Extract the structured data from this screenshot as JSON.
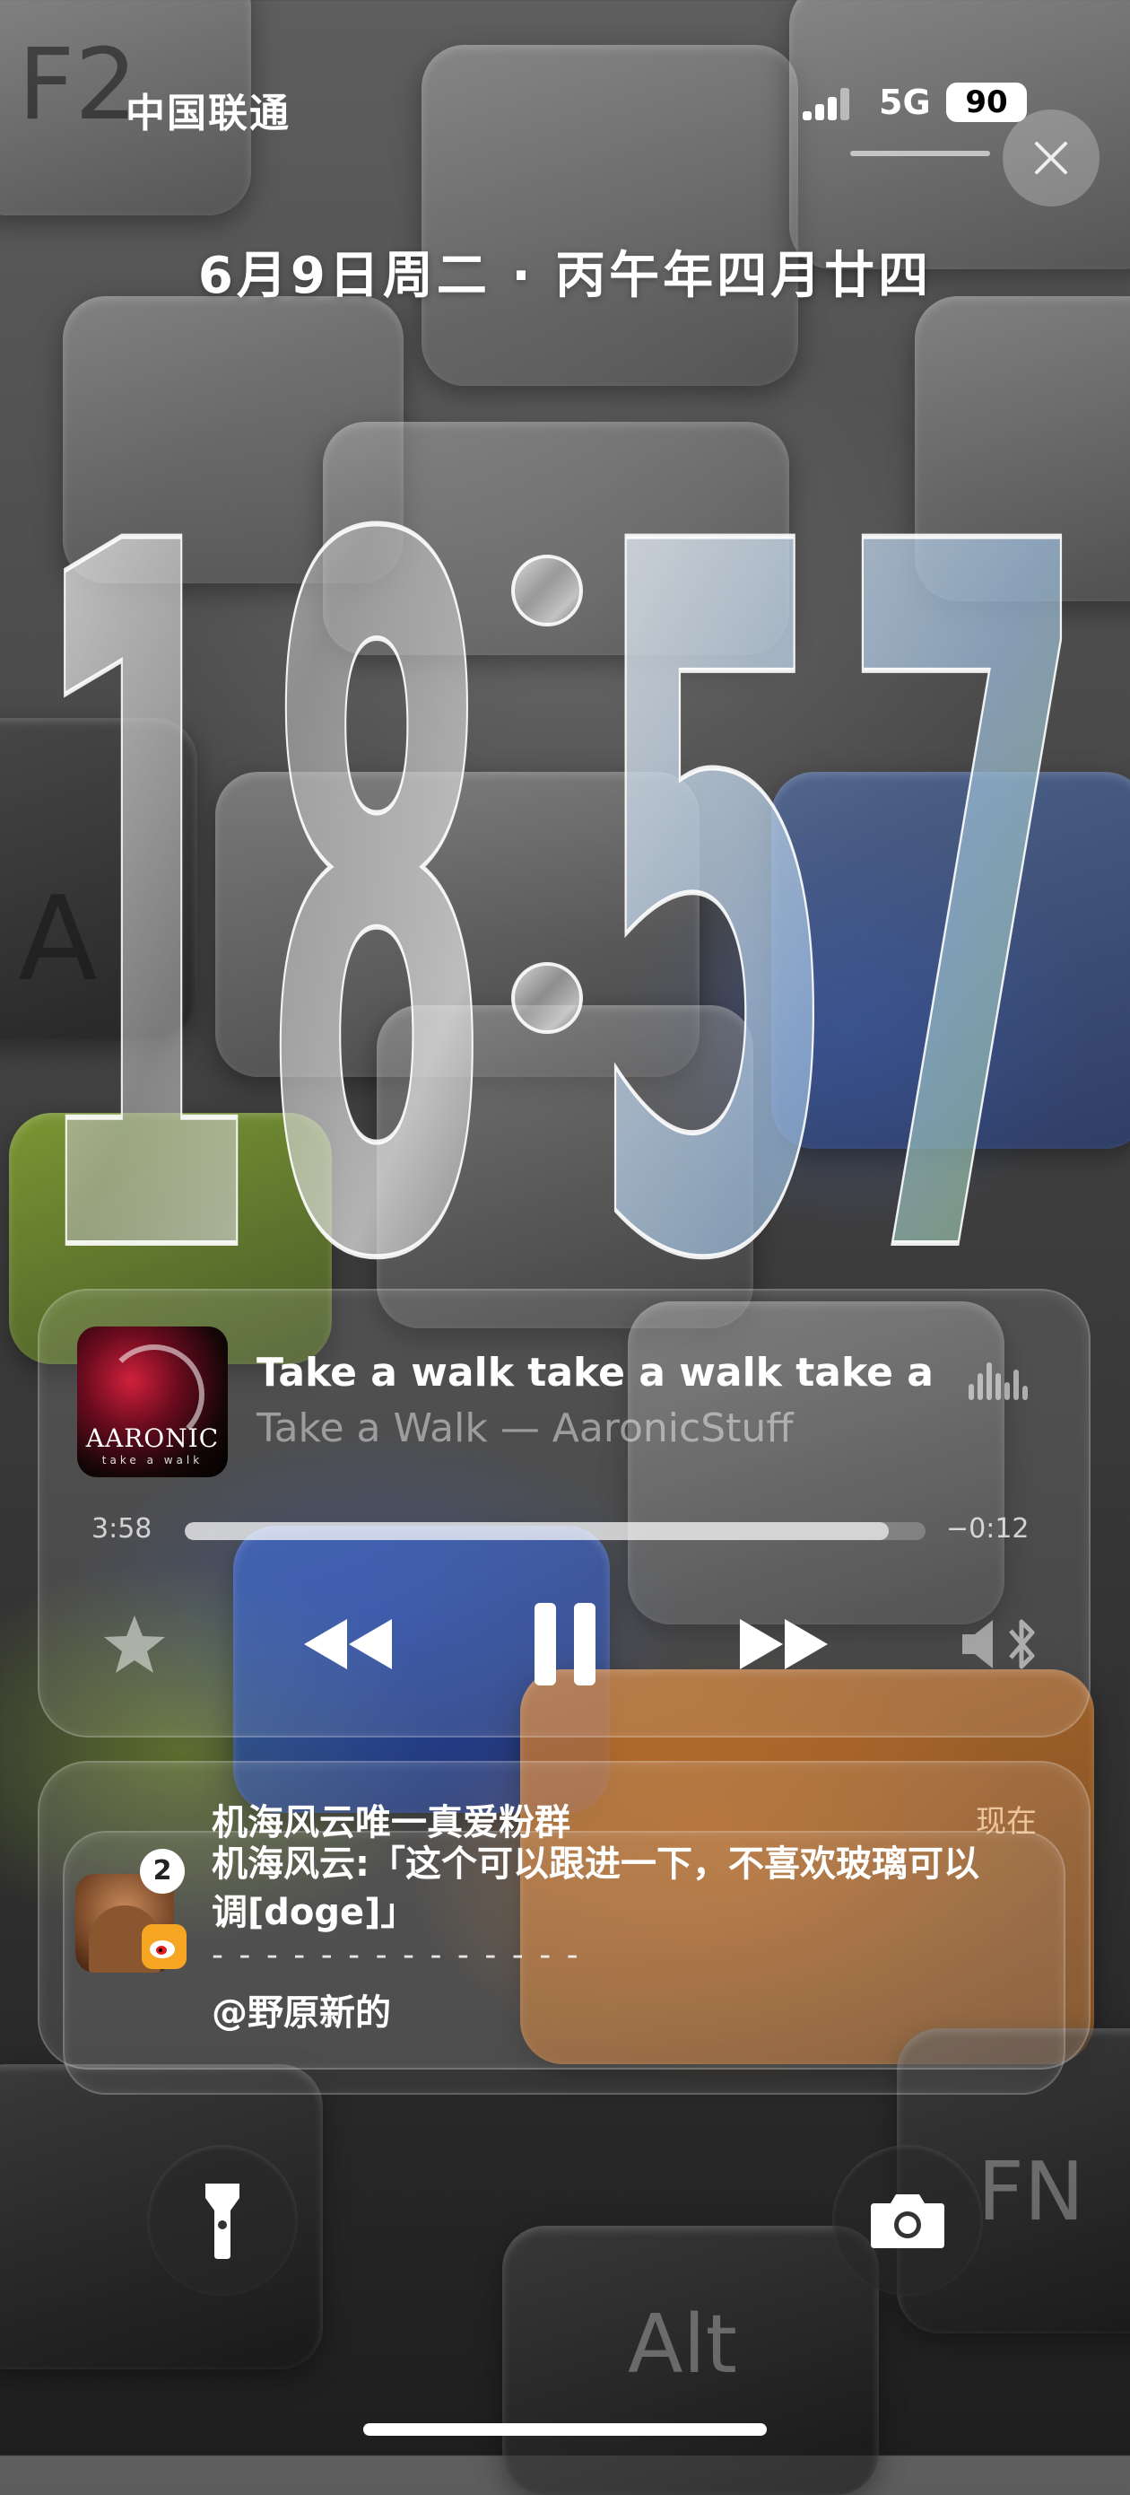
{
  "status_bar": {
    "carrier": "中国联通",
    "network": "5G",
    "battery": "90"
  },
  "lock_screen": {
    "date": "6月9日周二 · 丙午年四月廿四",
    "time_hours": "18",
    "time_minutes": "57"
  },
  "now_playing": {
    "album_art_text": "AARONIC",
    "album_art_subtext": "take a walk",
    "title": "Take a walk take a walk take a walk",
    "artist_line": "Take a Walk — AaronicStuff",
    "elapsed": "3:58",
    "remaining": "−0:12",
    "progress": 0.95
  },
  "notification": {
    "badge_count": "2",
    "app_icon": "weibo-icon",
    "title": "机海风云唯一真爱粉群",
    "time": "现在",
    "body": "机海风云:「这个可以跟进一下，不喜欢玻璃可以调[doge]」",
    "divider": "- - - - - - - - - - - - - -",
    "mention": "@野原新的"
  },
  "quick_actions": {
    "left_icon": "flashlight-icon",
    "right_icon": "camera-icon"
  },
  "colors": {
    "accent_orange": "#c8702a",
    "album_red": "#d0213b",
    "text_white": "#ffffff"
  }
}
